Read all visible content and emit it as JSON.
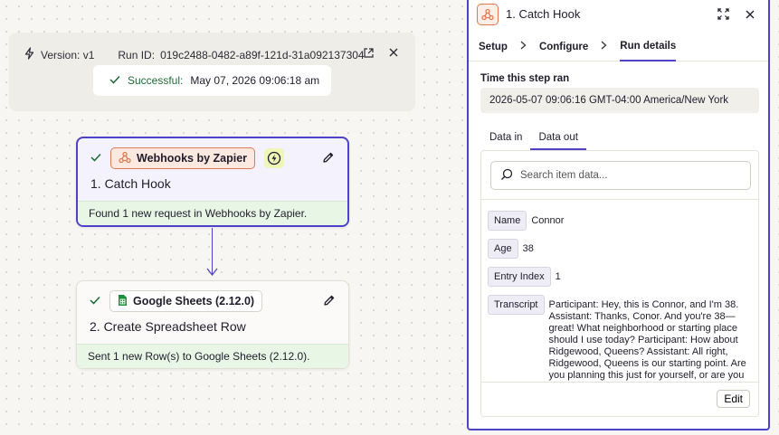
{
  "run_bar": {
    "version": "Version: v1",
    "run_id_label": "Run ID:",
    "run_id": "019c2488-0482-a89f-121d-31a092137304",
    "status": "Successful:",
    "timestamp": "May 07, 2026 09:06:18 am"
  },
  "nodes": [
    {
      "app": "Webhooks by Zapier",
      "title": "1. Catch Hook",
      "footer": "Found 1 new request in Webhooks by Zapier."
    },
    {
      "app": "Google Sheets (2.12.0)",
      "title": "2. Create Spreadsheet Row",
      "footer": "Sent 1 new Row(s) to Google Sheets (2.12.0)."
    }
  ],
  "panel": {
    "title": "1. Catch Hook",
    "crumbs": [
      "Setup",
      "Configure",
      "Run details"
    ],
    "time_label": "Time this step ran",
    "time_value": "2026-05-07 09:06:16 GMT-04:00 America/New York",
    "subtabs": [
      "Data in",
      "Data out"
    ],
    "search_placeholder": "Search item data...",
    "fields": [
      {
        "key": "Name",
        "value": "Connor"
      },
      {
        "key": "Age",
        "value": "38"
      },
      {
        "key": "Entry Index",
        "value": "1"
      },
      {
        "key": "Transcript",
        "value": "Participant: Hey, this is Connor, and I'm 38. Assistant: Thanks, Conor. And you're 38— great! What neighborhood or starting place should I use today? Participant: How about Ridgewood, Queens? Assistant: All right, Ridgewood, Queens is our starting point. Are you planning this just for yourself, or are you coordinating with someone"
      }
    ],
    "edit_label": "Edit"
  },
  "colors": {
    "accent": "#4f41c9",
    "webhook_orange": "#e07a52",
    "success_green": "#1e6a35",
    "footer_green": "#e8f7e5",
    "sheets_green": "#1e8e3e"
  },
  "icons": [
    "bolt-icon",
    "external-link-icon",
    "close-icon",
    "check-icon",
    "webhook-icon",
    "lightning-circle-icon",
    "pencil-icon",
    "sheets-icon",
    "expand-icon",
    "chevron-right-icon",
    "search-icon"
  ]
}
